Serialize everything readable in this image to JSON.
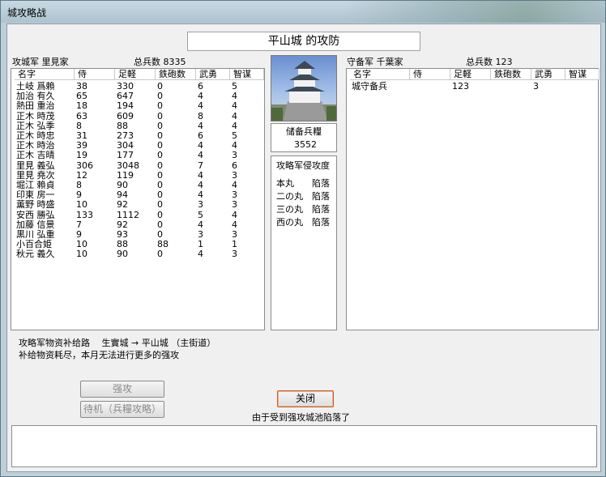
{
  "window": {
    "title": "城攻略战"
  },
  "castle_title": "平山城 的攻防",
  "attacker": {
    "label": "攻城军 里見家",
    "total_label": "总兵数 8335",
    "columns": [
      "名字",
      "侍",
      "足軽",
      "鉄砲数",
      "武勇",
      "智谋"
    ],
    "rows": [
      [
        "土岐 爲賴",
        "38",
        "330",
        "0",
        "6",
        "5"
      ],
      [
        "加治 有久",
        "65",
        "647",
        "0",
        "4",
        "4"
      ],
      [
        "熱田 重治",
        "18",
        "194",
        "0",
        "4",
        "4"
      ],
      [
        "正木 時茂",
        "63",
        "609",
        "0",
        "8",
        "4"
      ],
      [
        "正木 弘季",
        "8",
        "88",
        "0",
        "4",
        "4"
      ],
      [
        "正木 時忠",
        "31",
        "273",
        "0",
        "6",
        "5"
      ],
      [
        "正木 時治",
        "39",
        "304",
        "0",
        "4",
        "4"
      ],
      [
        "正木 吉晴",
        "19",
        "177",
        "0",
        "4",
        "3"
      ],
      [
        "里見 義弘",
        "306",
        "3048",
        "0",
        "7",
        "6"
      ],
      [
        "里見 堯次",
        "12",
        "119",
        "0",
        "4",
        "3"
      ],
      [
        "堀江 賴貞",
        "8",
        "90",
        "0",
        "4",
        "4"
      ],
      [
        "印東 房一",
        "9",
        "94",
        "0",
        "4",
        "3"
      ],
      [
        "薫野 時盛",
        "10",
        "92",
        "0",
        "3",
        "3"
      ],
      [
        "安西 勝弘",
        "133",
        "1112",
        "0",
        "5",
        "4"
      ],
      [
        "加藤 信景",
        "7",
        "92",
        "0",
        "4",
        "4"
      ],
      [
        "黒川 弘重",
        "9",
        "93",
        "0",
        "3",
        "3"
      ],
      [
        "小百合姫",
        "10",
        "88",
        "88",
        "1",
        "1"
      ],
      [
        "秋元 義久",
        "10",
        "90",
        "0",
        "4",
        "3"
      ]
    ]
  },
  "defender": {
    "label": "守备军 千葉家",
    "total_label": "总兵数 123",
    "columns": [
      "名字",
      "侍",
      "足軽",
      "鉄砲数",
      "武勇",
      "智谋"
    ],
    "rows": [
      [
        "城守备兵",
        "",
        "123",
        "",
        "3",
        ""
      ]
    ]
  },
  "reserve": {
    "label": "储备兵糧",
    "value": "3552"
  },
  "progress": {
    "title": "攻略军侵攻度",
    "items": [
      {
        "name": "本丸",
        "status": "陷落"
      },
      {
        "name": "二の丸",
        "status": "陷落"
      },
      {
        "name": "三の丸",
        "status": "陷落"
      },
      {
        "name": "西の丸",
        "status": "陷落"
      }
    ]
  },
  "supply": {
    "route": "攻略军物资补给路　 生實城 → 平山城 （主街道）",
    "message": "补给物资耗尽，本月无法进行更多的强攻"
  },
  "buttons": {
    "assault": "强攻",
    "wait": "待机（兵糧攻略）",
    "close": "关闭"
  },
  "status": "由于受到强攻城池陷落了",
  "log_text": ""
}
